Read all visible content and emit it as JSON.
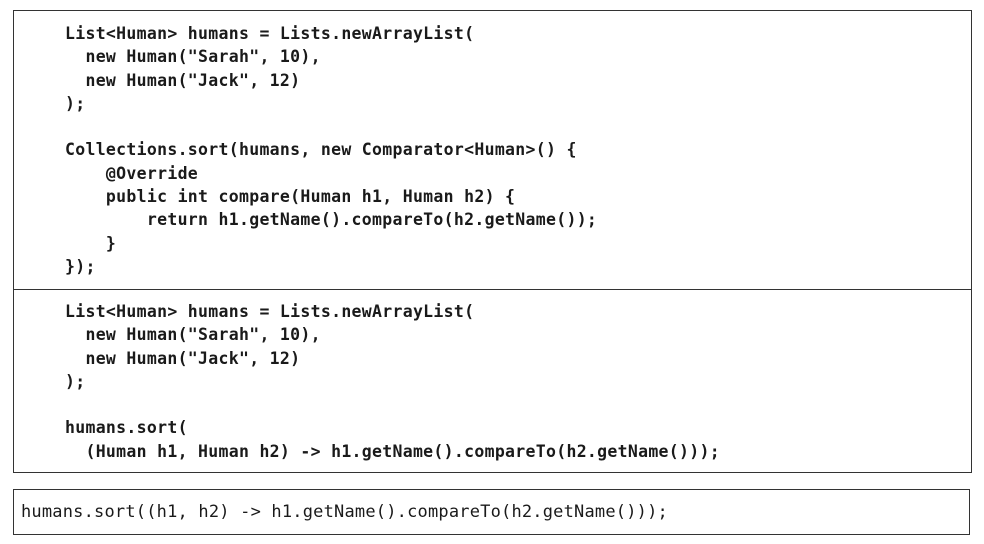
{
  "snippets": [
    {
      "lines": [
        "List<Human> humans = Lists.newArrayList(",
        "  new Human(\"Sarah\", 10),",
        "  new Human(\"Jack\", 12)",
        ");",
        "",
        "Collections.sort(humans, new Comparator<Human>() {",
        "    @Override",
        "    public int compare(Human h1, Human h2) {",
        "        return h1.getName().compareTo(h2.getName());",
        "    }",
        "});"
      ]
    },
    {
      "lines": [
        "List<Human> humans = Lists.newArrayList(",
        "  new Human(\"Sarah\", 10),",
        "  new Human(\"Jack\", 12)",
        ");",
        "",
        "humans.sort(",
        "  (Human h1, Human h2) -> h1.getName().compareTo(h2.getName()));"
      ]
    },
    {
      "lines": [
        "humans.sort((h1, h2) -> h1.getName().compareTo(h2.getName()));"
      ]
    }
  ]
}
